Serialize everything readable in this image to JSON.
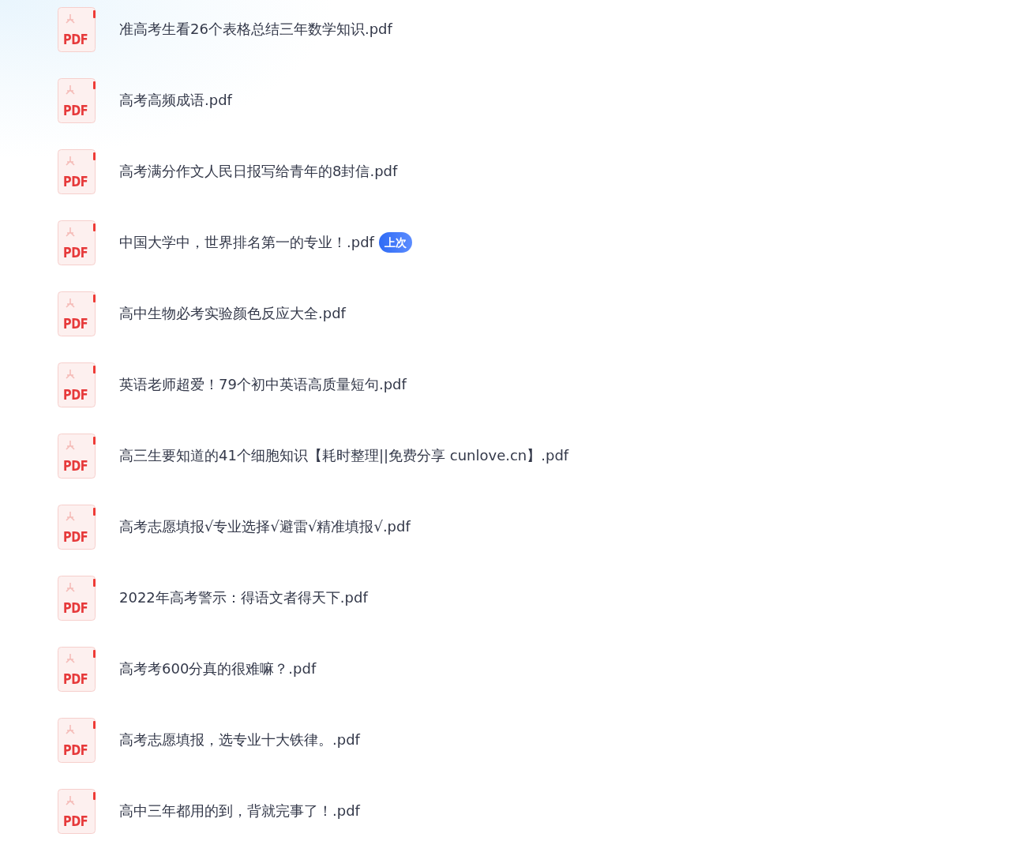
{
  "files": [
    {
      "icon_label": "PDF",
      "name": "准高考生看26个表格总结三年数学知识.pdf"
    },
    {
      "icon_label": "PDF",
      "name": "高考高频成语.pdf"
    },
    {
      "icon_label": "PDF",
      "name": "高考满分作文人民日报写给青年的8封信.pdf"
    },
    {
      "icon_label": "PDF",
      "name": "中国大学中，世界排名第一的专业！.pdf",
      "badge": "上次"
    },
    {
      "icon_label": "PDF",
      "name": "高中生物必考实验颜色反应大全.pdf"
    },
    {
      "icon_label": "PDF",
      "name": "英语老师超爱！79个初中英语高质量短句.pdf"
    },
    {
      "icon_label": "PDF",
      "name": "高三生要知道的41个细胞知识【耗时整理||免费分享 cunlove.cn】.pdf"
    },
    {
      "icon_label": "PDF",
      "name": "高考志愿填报√专业选择√避雷√精准填报√.pdf"
    },
    {
      "icon_label": "PDF",
      "name": "2022年高考警示：得语文者得天下.pdf"
    },
    {
      "icon_label": "PDF",
      "name": "高考考600分真的很难嘛？.pdf"
    },
    {
      "icon_label": "PDF",
      "name": "高考志愿填报，选专业十大铁律。.pdf"
    },
    {
      "icon_label": "PDF",
      "name": "高中三年都用的到，背就完事了！.pdf"
    }
  ]
}
